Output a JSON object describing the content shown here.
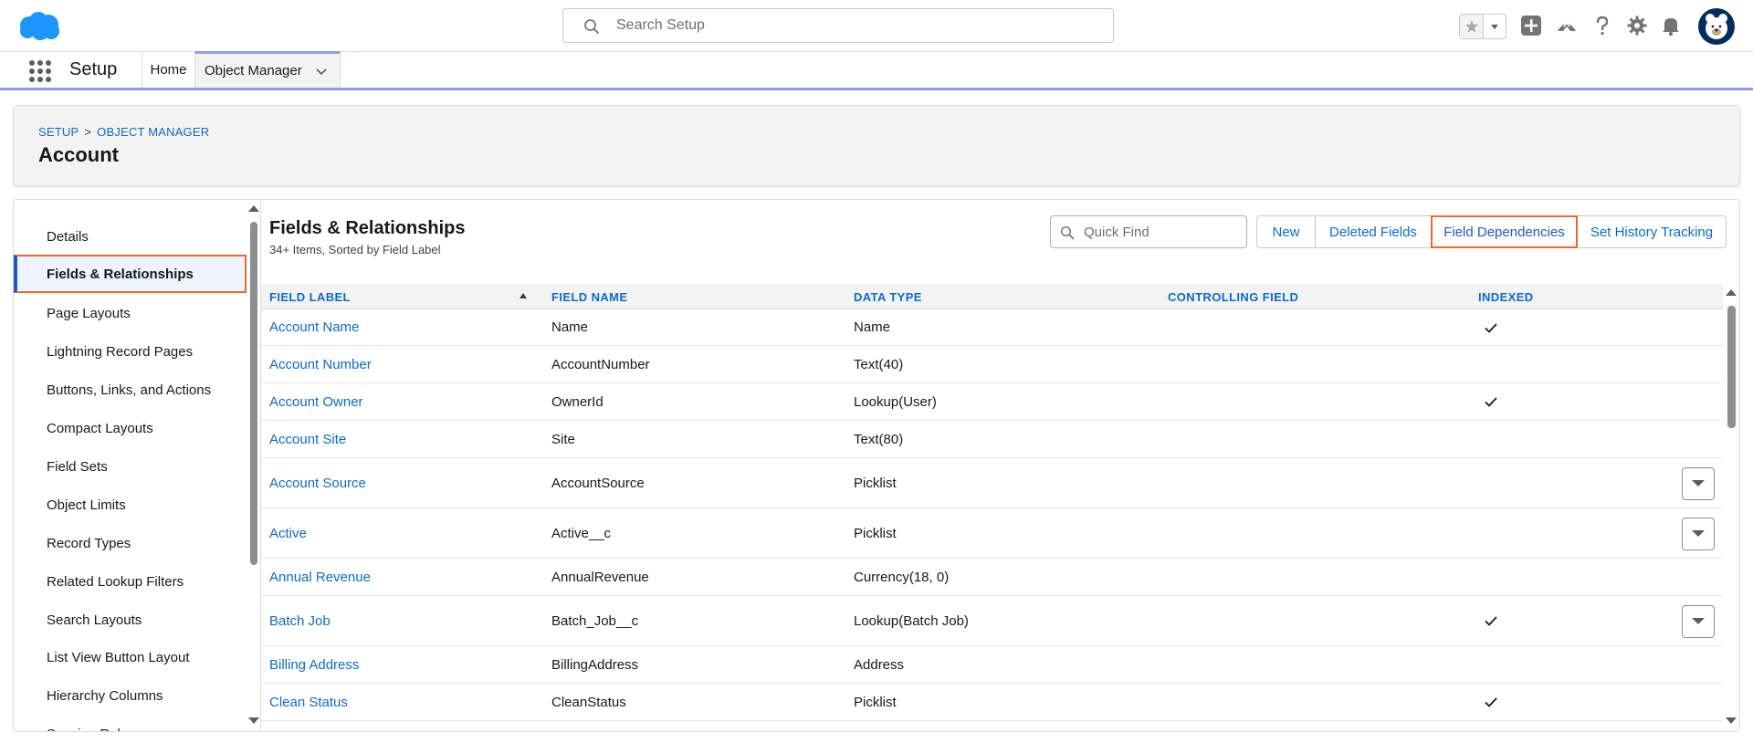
{
  "header": {
    "search_placeholder": "Search Setup"
  },
  "nav": {
    "app_name": "Setup",
    "home": "Home",
    "object_manager": "Object Manager"
  },
  "page": {
    "breadcrumb": [
      "Setup",
      "Object Manager"
    ],
    "breadcrumb_sep": ">",
    "title": "Account"
  },
  "sidebar": {
    "items": [
      {
        "label": "Details"
      },
      {
        "label": "Fields & Relationships"
      },
      {
        "label": "Page Layouts"
      },
      {
        "label": "Lightning Record Pages"
      },
      {
        "label": "Buttons, Links, and Actions"
      },
      {
        "label": "Compact Layouts"
      },
      {
        "label": "Field Sets"
      },
      {
        "label": "Object Limits"
      },
      {
        "label": "Record Types"
      },
      {
        "label": "Related Lookup Filters"
      },
      {
        "label": "Search Layouts"
      },
      {
        "label": "List View Button Layout"
      },
      {
        "label": "Hierarchy Columns"
      },
      {
        "label": "Scoping Rules"
      }
    ],
    "active_index": 1
  },
  "section": {
    "title": "Fields & Relationships",
    "subtitle": "34+ Items, Sorted by Field Label",
    "quick_find_placeholder": "Quick Find",
    "buttons": {
      "new": "New",
      "deleted_fields": "Deleted Fields",
      "field_dependencies": "Field Dependencies",
      "set_history_tracking": "Set History Tracking"
    }
  },
  "table": {
    "columns": {
      "field_label": "Field Label",
      "field_name": "Field Name",
      "data_type": "Data Type",
      "controlling_field": "Controlling Field",
      "indexed": "Indexed"
    },
    "rows": [
      {
        "label": "Account Name",
        "name": "Name",
        "type": "Name",
        "controlling": "",
        "indexed": true,
        "action": false
      },
      {
        "label": "Account Number",
        "name": "AccountNumber",
        "type": "Text(40)",
        "controlling": "",
        "indexed": false,
        "action": false
      },
      {
        "label": "Account Owner",
        "name": "OwnerId",
        "type": "Lookup(User)",
        "controlling": "",
        "indexed": true,
        "action": false
      },
      {
        "label": "Account Site",
        "name": "Site",
        "type": "Text(80)",
        "controlling": "",
        "indexed": false,
        "action": false
      },
      {
        "label": "Account Source",
        "name": "AccountSource",
        "type": "Picklist",
        "controlling": "",
        "indexed": false,
        "action": true
      },
      {
        "label": "Active",
        "name": "Active__c",
        "type": "Picklist",
        "controlling": "",
        "indexed": false,
        "action": true
      },
      {
        "label": "Annual Revenue",
        "name": "AnnualRevenue",
        "type": "Currency(18, 0)",
        "controlling": "",
        "indexed": false,
        "action": false
      },
      {
        "label": "Batch Job",
        "name": "Batch_Job__c",
        "type": "Lookup(Batch Job)",
        "controlling": "",
        "indexed": true,
        "action": true
      },
      {
        "label": "Billing Address",
        "name": "BillingAddress",
        "type": "Address",
        "controlling": "",
        "indexed": false,
        "action": false
      },
      {
        "label": "Clean Status",
        "name": "CleanStatus",
        "type": "Picklist",
        "controlling": "",
        "indexed": true,
        "action": false
      }
    ]
  },
  "colors": {
    "brand_blue": "#0b6bcb",
    "highlight_orange": "#e8692a",
    "salesforce_cloud": "#1b96ff",
    "tab_accent": "#8a9fe8"
  },
  "icons": {
    "logo": "salesforce-cloud-logo",
    "search": "search-icon",
    "favorites": "star-icon",
    "add": "plus-icon",
    "trailhead": "trailhead-icon",
    "help": "question-icon",
    "settings": "gear-icon",
    "notifications": "bell-icon",
    "check": "check-icon"
  }
}
